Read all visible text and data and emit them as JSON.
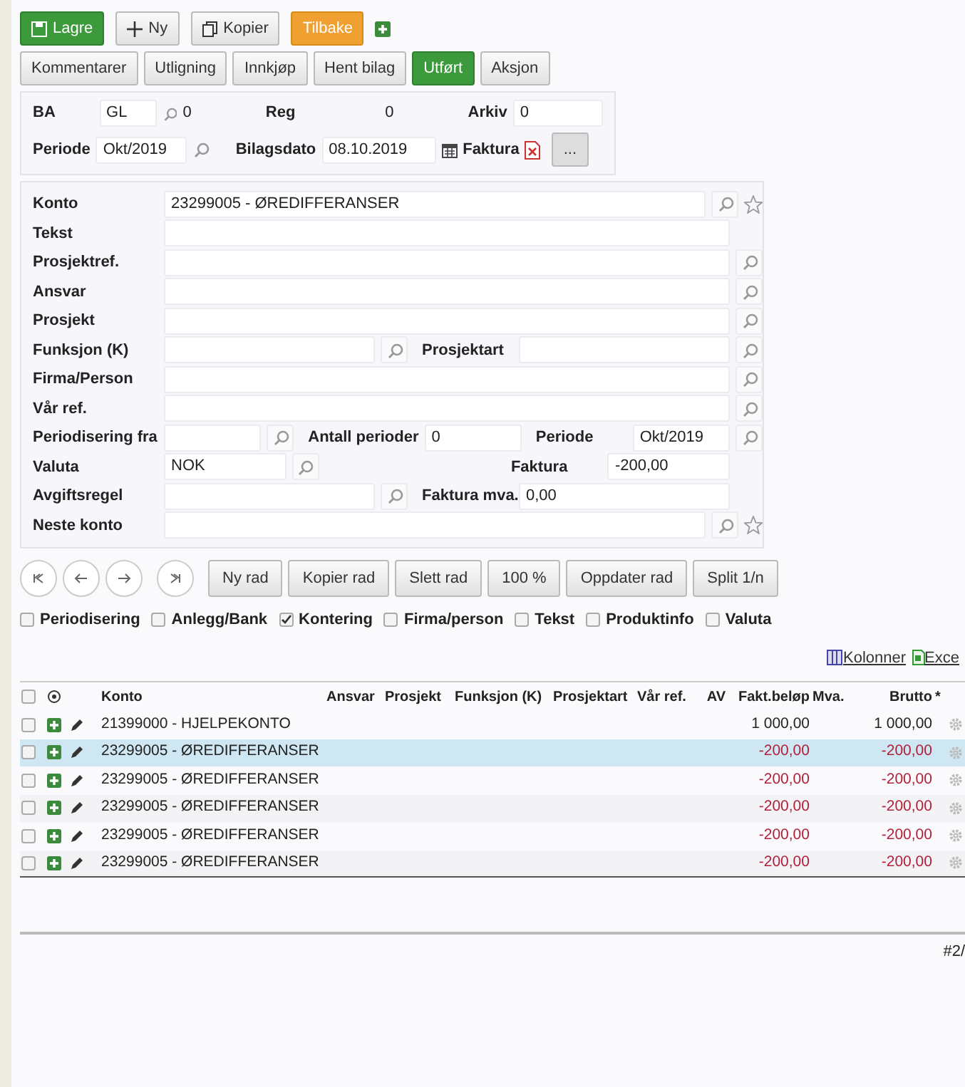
{
  "toolbar": [
    {
      "label": "Lagre",
      "kind": "save"
    },
    {
      "label": "Ny",
      "kind": "new"
    },
    {
      "label": "Kopier",
      "kind": "copy"
    },
    {
      "label": "Tilbake",
      "kind": "back"
    }
  ],
  "tabs": [
    {
      "label": "Kommentarer",
      "selected": false
    },
    {
      "label": "Utligning",
      "selected": false
    },
    {
      "label": "Innkjøp",
      "selected": false
    },
    {
      "label": "Hent bilag",
      "selected": false
    },
    {
      "label": "Utført",
      "selected": true
    },
    {
      "label": "Aksjon",
      "selected": false
    }
  ],
  "header": {
    "ba_label": "BA",
    "ba_value": "GL",
    "ba_count": "0",
    "reg_label": "Reg",
    "reg_value": "0",
    "arkiv_label": "Arkiv",
    "arkiv_value": "0",
    "periode_label": "Periode",
    "periode_value": "Okt/2019",
    "bilagsdato_label": "Bilagsdato",
    "bilagsdato_value": "08.10.2019",
    "faktura_label": "Faktura",
    "more_button": "..."
  },
  "form_rows": [
    {
      "items": [
        {
          "kind": "label",
          "text": "Konto"
        },
        {
          "kind": "field",
          "value": "23299005 - ØREDIFFERANSER"
        },
        {
          "kind": "search"
        },
        {
          "kind": "star"
        }
      ]
    },
    {
      "items": [
        {
          "kind": "label",
          "text": "Tekst"
        },
        {
          "kind": "field"
        },
        {
          "kind": "gap"
        }
      ]
    },
    {
      "items": [
        {
          "kind": "label",
          "text": "Prosjektref."
        },
        {
          "kind": "field"
        },
        {
          "kind": "search"
        }
      ]
    },
    {
      "items": [
        {
          "kind": "label",
          "text": "Ansvar"
        },
        {
          "kind": "field"
        },
        {
          "kind": "search"
        }
      ]
    },
    {
      "items": [
        {
          "kind": "label",
          "text": "Prosjekt"
        },
        {
          "kind": "field"
        },
        {
          "kind": "search"
        }
      ]
    },
    {
      "items": [
        {
          "kind": "label",
          "text": "Funksjon (K)"
        },
        {
          "kind": "field"
        },
        {
          "kind": "search"
        },
        {
          "kind": "label2",
          "text": "Prosjektart"
        },
        {
          "kind": "field"
        },
        {
          "kind": "search"
        }
      ]
    },
    {
      "items": [
        {
          "kind": "label",
          "text": "Firma/Person"
        },
        {
          "kind": "field"
        },
        {
          "kind": "search"
        }
      ]
    },
    {
      "items": [
        {
          "kind": "label",
          "text": "Vår ref."
        },
        {
          "kind": "field"
        },
        {
          "kind": "search"
        }
      ]
    },
    {
      "items": [
        {
          "kind": "label",
          "text": "Periodisering fra"
        },
        {
          "kind": "field"
        },
        {
          "kind": "search"
        },
        {
          "kind": "label3",
          "text": "Antall perioder"
        },
        {
          "kind": "field",
          "value": "0"
        },
        {
          "kind": "label2",
          "text": "Periode"
        },
        {
          "kind": "field",
          "value": "Okt/2019"
        },
        {
          "kind": "search"
        }
      ]
    },
    {
      "items": [
        {
          "kind": "label",
          "text": "Valuta"
        },
        {
          "kind": "field",
          "value": "NOK"
        },
        {
          "kind": "search"
        },
        {
          "kind": "space"
        },
        {
          "kind": "label2",
          "text": "Faktura"
        },
        {
          "kind": "field",
          "value": "-200,00"
        },
        {
          "kind": "gap"
        }
      ]
    },
    {
      "items": [
        {
          "kind": "label",
          "text": "Avgiftsregel"
        },
        {
          "kind": "field"
        },
        {
          "kind": "search"
        },
        {
          "kind": "label2",
          "text": "Faktura mva."
        },
        {
          "kind": "field",
          "value": "0,00"
        },
        {
          "kind": "gap"
        }
      ]
    },
    {
      "items": [
        {
          "kind": "label",
          "text": "Neste konto"
        },
        {
          "kind": "field"
        },
        {
          "kind": "search"
        },
        {
          "kind": "star"
        }
      ]
    }
  ],
  "row_actions": [
    "Ny rad",
    "Kopier rad",
    "Slett rad",
    "100 %",
    "Oppdater rad",
    "Split 1/n"
  ],
  "options": [
    {
      "label": "Periodisering",
      "checked": false
    },
    {
      "label": "Anlegg/Bank",
      "checked": false
    },
    {
      "label": "Kontering",
      "checked": true
    },
    {
      "label": "Firma/person",
      "checked": false
    },
    {
      "label": "Tekst",
      "checked": false
    },
    {
      "label": "Produktinfo",
      "checked": false
    },
    {
      "label": "Valuta",
      "checked": false
    }
  ],
  "table_links": [
    "Kolonner",
    "Exce"
  ],
  "table": {
    "all_checked": false,
    "columns": [
      "Konto",
      "Ansvar",
      "Prosjekt",
      "Funksjon (K)",
      "Prosjektart",
      "Vår ref.",
      "AV",
      "Fakt.beløp",
      "Mva.",
      "Brutto",
      "*"
    ],
    "rows": [
      {
        "konto": "21399000 - HJELPEKONTO",
        "fakt": "1 000,00",
        "brutto": "1 000,00",
        "negative": false,
        "selected": false
      },
      {
        "konto": "23299005 - ØREDIFFERANSER",
        "fakt": "-200,00",
        "brutto": "-200,00",
        "negative": true,
        "selected": true
      },
      {
        "konto": "23299005 - ØREDIFFERANSER",
        "fakt": "-200,00",
        "brutto": "-200,00",
        "negative": true,
        "selected": false
      },
      {
        "konto": "23299005 - ØREDIFFERANSER",
        "fakt": "-200,00",
        "brutto": "-200,00",
        "negative": true,
        "selected": false
      },
      {
        "konto": "23299005 - ØREDIFFERANSER",
        "fakt": "-200,00",
        "brutto": "-200,00",
        "negative": true,
        "selected": false
      },
      {
        "konto": "23299005 - ØREDIFFERANSER",
        "fakt": "-200,00",
        "brutto": "-200,00",
        "negative": true,
        "selected": false
      }
    ]
  },
  "record_counter": "#2/"
}
